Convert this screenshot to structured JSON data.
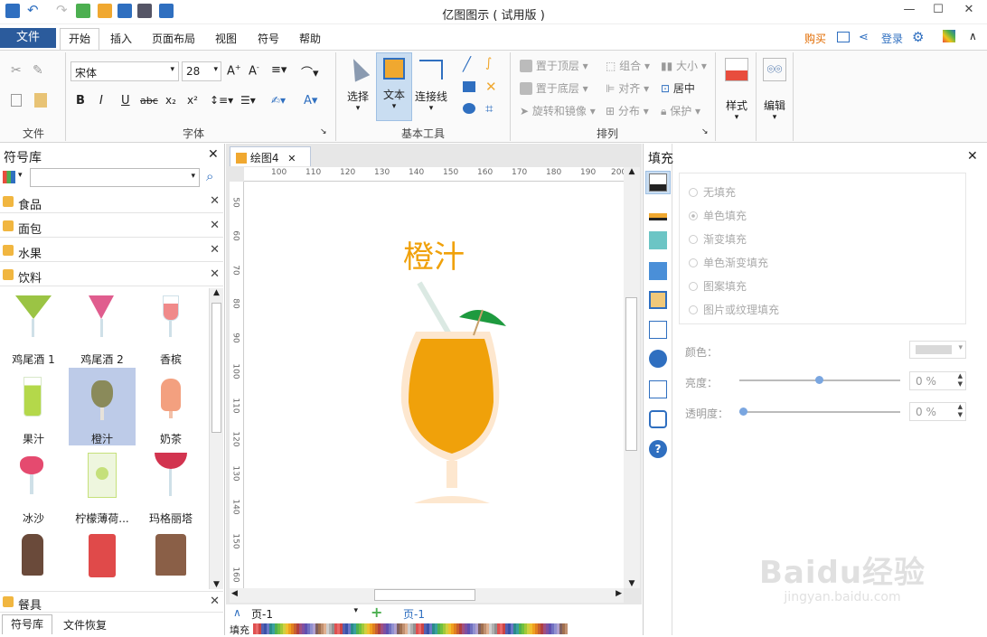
{
  "window": {
    "title": "亿图图示 ( 试用版 )"
  },
  "ribbon": {
    "file_tab": "文件",
    "tabs": [
      "开始",
      "插入",
      "页面布局",
      "视图",
      "符号",
      "帮助"
    ],
    "right": {
      "buy": "购买",
      "login": "登录"
    },
    "font": {
      "name": "宋体",
      "size": "28"
    },
    "groups": {
      "file": "文件",
      "font": "字体",
      "basic_tools": "基本工具",
      "arrange": "排列"
    },
    "tools": {
      "select": "选择",
      "text": "文本",
      "connector": "连接线"
    },
    "arrange": {
      "bring_front": "置于顶层",
      "send_back": "置于底层",
      "rotate": "旋转和镜像",
      "group": "组合",
      "align": "对齐",
      "distribute": "分布",
      "size": "大小",
      "center": "居中",
      "protect": "保护"
    },
    "style": "样式",
    "edit": "编辑"
  },
  "library": {
    "title": "符号库",
    "categories": [
      "食品",
      "面包",
      "水果",
      "饮料"
    ],
    "bottom_category": "餐具",
    "symbols": [
      {
        "label": "鸡尾酒 1",
        "color": "#9bc444"
      },
      {
        "label": "鸡尾酒 2",
        "color": "#e05d8e"
      },
      {
        "label": "香槟",
        "color": "#f08a8a"
      },
      {
        "label": "果汁",
        "color": "#b4d84a"
      },
      {
        "label": "橙汁",
        "color": "#8a8a5a"
      },
      {
        "label": "奶茶",
        "color": "#f3a07f"
      },
      {
        "label": "冰沙",
        "color": "#e54a6f"
      },
      {
        "label": "柠檬薄荷...",
        "color": "#c5e07a"
      },
      {
        "label": "玛格丽塔",
        "color": "#d2344f"
      },
      {
        "label": "",
        "color": "#6a4a3a"
      },
      {
        "label": "",
        "color": "#e04a4a"
      },
      {
        "label": "",
        "color": "#8a5f47"
      }
    ],
    "tabs": [
      "符号库",
      "文件恢复"
    ]
  },
  "canvas": {
    "doc_tab": "绘图4",
    "ruler_h": [
      "100",
      "110",
      "120",
      "130",
      "140",
      "150",
      "160",
      "170",
      "180",
      "190",
      "200"
    ],
    "ruler_v": [
      "50",
      "60",
      "70",
      "80",
      "90",
      "100",
      "110",
      "120",
      "130",
      "140",
      "150",
      "160"
    ],
    "shape_title": "橙汁",
    "page_selector": "页-1",
    "page_tab": "页-1",
    "fill_label": "填充"
  },
  "fill_panel": {
    "title": "填充",
    "options": [
      "无填充",
      "单色填充",
      "渐变填充",
      "单色渐变填充",
      "图案填充",
      "图片或纹理填充"
    ],
    "selected_option": "单色填充",
    "color_label": "颜色：",
    "brightness_label": "亮度：",
    "brightness_value": "0 %",
    "transparency_label": "透明度：",
    "transparency_value": "0 %"
  },
  "watermark": {
    "text": "Baidu经验",
    "url": "jingyan.baidu.com"
  }
}
